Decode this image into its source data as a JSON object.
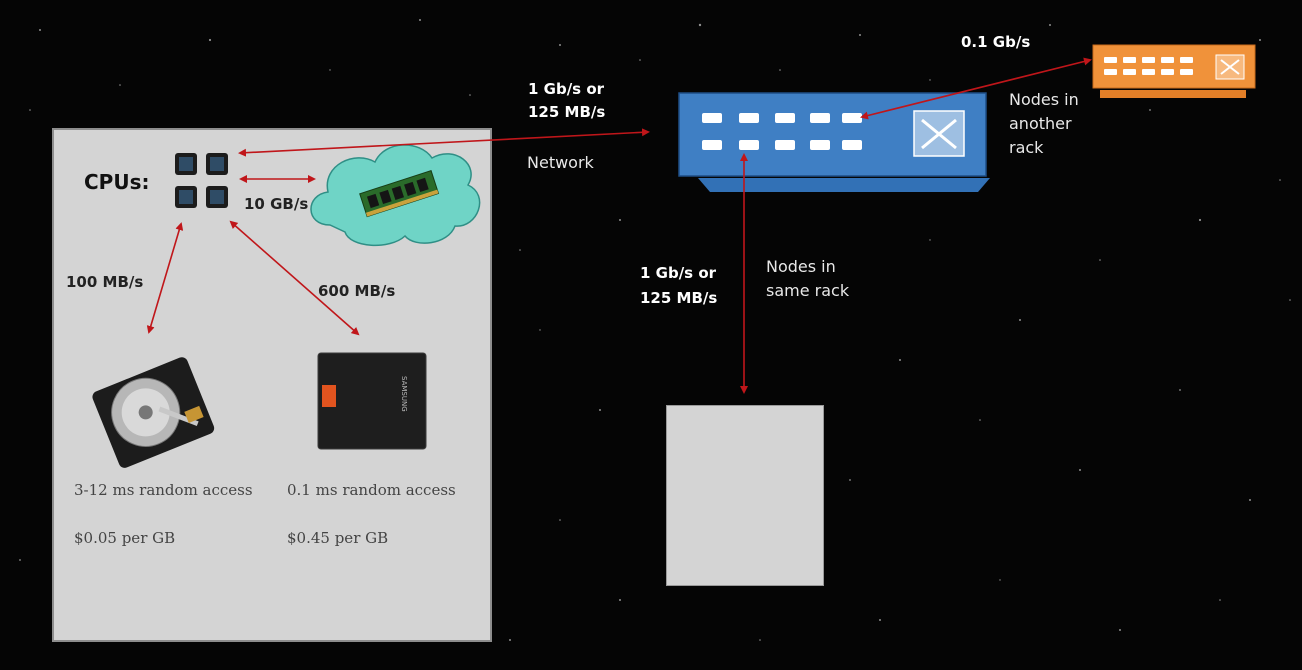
{
  "node": {
    "cpus_label": "CPUs:",
    "ram_bandwidth": "10 GB/s",
    "hdd_bandwidth": "100 MB/s",
    "ssd_bandwidth": "600 MB/s",
    "hdd_access": "3-12 ms random access",
    "hdd_cost": "$0.05 per GB",
    "ssd_access": "0.1 ms random access",
    "ssd_cost": "$0.45 per GB",
    "ssd_brand": "SAMSUNG"
  },
  "network": {
    "uplink_line1": "1 Gb/s or",
    "uplink_line2": "125 MB/s",
    "label": "Network",
    "same_rack_bw_line1": "1 Gb/s or",
    "same_rack_bw_line2": "125 MB/s",
    "same_rack_line1": "Nodes in",
    "same_rack_line2": "same rack",
    "other_rack_bw": "0.1 Gb/s",
    "other_rack_line1": "Nodes in",
    "other_rack_line2": "another",
    "other_rack_line3": "rack"
  },
  "colors": {
    "arrow": "#c0161a",
    "switch_blue": "#3f7fc4",
    "switch_orange": "#f0923a",
    "node_gray": "#d4d4d4"
  }
}
